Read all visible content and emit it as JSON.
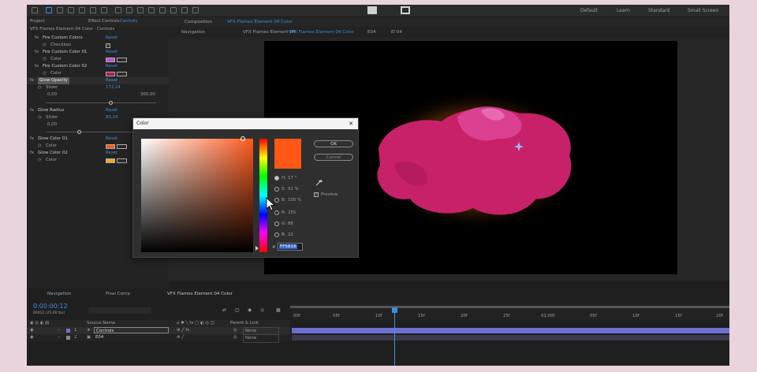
{
  "toolbar": {
    "tools": [
      "home",
      "select",
      "hand",
      "zoom",
      "orbit",
      "pan",
      "dolly",
      "rect",
      "pen",
      "type",
      "brush",
      "clone",
      "eraser",
      "roto",
      "puppet"
    ],
    "workspaces": [
      "Default",
      "Learn",
      "Standard",
      "Small Screen"
    ]
  },
  "ec_panel": {
    "tab_project": "Project",
    "tab_title": "Effect Controls",
    "tab_target": "Controls",
    "header": "VFX Flames Element 04 Color · Controls"
  },
  "effects": [
    {
      "name": "Fire Custom Colors",
      "reset": "Reset",
      "sub": "Checkbox"
    },
    {
      "name": "Fire Custom Color 01",
      "reset": "Reset",
      "sub": "Color",
      "color": "#c34fd6"
    },
    {
      "name": "Fire Custom Color 02",
      "reset": "Reset",
      "sub": "Color",
      "color": "#b2174e"
    },
    {
      "name": "Glow Opacity",
      "reset": "Reset",
      "sub": "Slider",
      "value": "172,14",
      "min": "0,00",
      "max": "300,00",
      "level": 0.574
    },
    {
      "name": "Glow Radius",
      "reset": "Reset",
      "sub": "Slider",
      "value": "83,24",
      "min": "0,00",
      "level": 0.277
    },
    {
      "name": "Glow Color 01",
      "reset": "Reset",
      "sub": "Color",
      "color": "#ff5816"
    },
    {
      "name": "Glow Color 02",
      "reset": "Reset",
      "sub": "Color",
      "color": "#f6a81c"
    }
  ],
  "comp": {
    "tab": "Composition",
    "tab_name": "VFX Flames Element 04 Color",
    "nav_label": "Navigation",
    "crumbs": [
      "VFX Flames Element 04",
      "VFX Flames Element 04 Color",
      "E04",
      "El 04"
    ]
  },
  "dialog": {
    "title": "Color",
    "close": "✕",
    "ok": "OK",
    "cancel": "Cancel",
    "preview": "Preview",
    "current_color": "#ff5816",
    "hsb": [
      {
        "label": "H:",
        "value": "17 °"
      },
      {
        "label": "S:",
        "value": "91 %"
      },
      {
        "label": "B:",
        "value": "100 %"
      },
      {
        "label": "R:",
        "value": "255"
      },
      {
        "label": "G:",
        "value": "88"
      },
      {
        "label": "B:",
        "value": "22"
      }
    ],
    "hex_label": "#",
    "hex": "FF5816"
  },
  "timeline": {
    "tabs": [
      "Navigation",
      "Final Comp",
      "VFX Flames Element 04 Color"
    ],
    "timecode": "0:00:00:12",
    "fps": "00012 (25.00 fps)",
    "col_source": "Source Name",
    "col_parent": "Parent & Link",
    "ruler": [
      "00f",
      "05f",
      "10f",
      "15f",
      "20f",
      "25f",
      "01:00f",
      "05f",
      "10f",
      "15f",
      "20f"
    ],
    "layers": [
      {
        "num": "1",
        "name": "Controls",
        "parent": "None"
      },
      {
        "num": "2",
        "name": "E04",
        "parent": "None"
      }
    ]
  }
}
